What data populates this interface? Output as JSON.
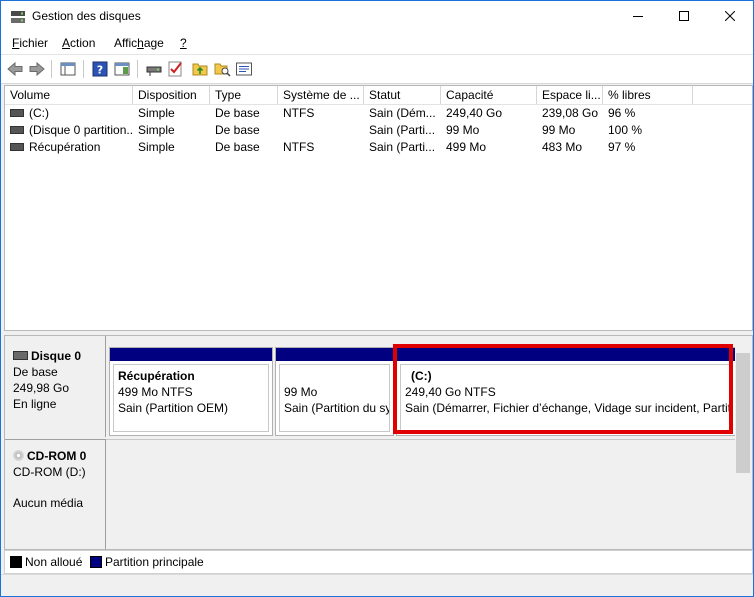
{
  "window": {
    "title": "Gestion des disques"
  },
  "menu": [
    {
      "label": "Fichier",
      "underline": "F",
      "rest": "ichier"
    },
    {
      "label": "Action",
      "underline": "A",
      "rest": "ction"
    },
    {
      "label": "Affichage",
      "pre": "Affic",
      "underline": "h",
      "rest": "age"
    },
    {
      "label": "?",
      "underline": "?",
      "rest": ""
    }
  ],
  "columns": [
    "Volume",
    "Disposition",
    "Type",
    "Système de ...",
    "Statut",
    "Capacité",
    "Espace li...",
    "% libres"
  ],
  "volumes": [
    {
      "volume": "(C:)",
      "disposition": "Simple",
      "type": "De base",
      "fs": "NTFS",
      "statut": "Sain (Dém...",
      "capacite": "249,40 Go",
      "espace": "239,08 Go",
      "libres": "96 %"
    },
    {
      "volume": "(Disque 0 partition...",
      "disposition": "Simple",
      "type": "De base",
      "fs": "",
      "statut": "Sain (Parti...",
      "capacite": "99 Mo",
      "espace": "99 Mo",
      "libres": "100 %"
    },
    {
      "volume": "Récupération",
      "disposition": "Simple",
      "type": "De base",
      "fs": "NTFS",
      "statut": "Sain (Parti...",
      "capacite": "499 Mo",
      "espace": "483 Mo",
      "libres": "97 %"
    }
  ],
  "disk0": {
    "name": "Disque 0",
    "type": "De base",
    "size": "249,98 Go",
    "state": "En ligne",
    "partitions": [
      {
        "title": "Récupération",
        "line1": "499 Mo NTFS",
        "line2": "Sain (Partition OEM)"
      },
      {
        "title": "",
        "line1": "99 Mo",
        "line2": "Sain (Partition du sys"
      },
      {
        "title": "(C:)",
        "line1": "249,40 Go NTFS",
        "line2": "Sain (Démarrer, Fichier d’échange, Vidage sur incident, Partiti"
      }
    ]
  },
  "cdrom0": {
    "name": "CD-ROM 0",
    "drive": "CD-ROM (D:)",
    "media": "Aucun média"
  },
  "legend": {
    "unallocated": "Non alloué",
    "primary": "Partition principale",
    "unallocated_color": "#000000",
    "primary_color": "#000080"
  },
  "colors": {
    "highlight": "#e00000",
    "partition_bar": "#000080"
  }
}
